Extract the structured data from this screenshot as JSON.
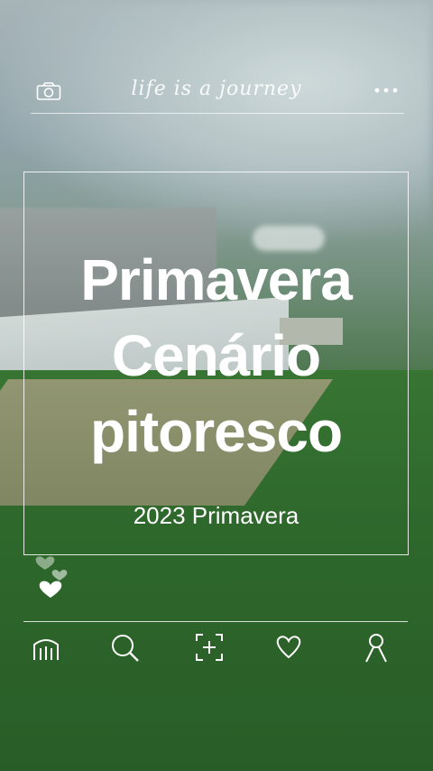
{
  "header": {
    "tagline": "life is a journey",
    "camera_icon": "camera-icon",
    "more_icon": "more-dots-icon"
  },
  "card": {
    "title_lines": [
      "Primavera",
      "Cenário",
      "pitoresco"
    ],
    "subtitle": "2023 Primavera"
  },
  "decor": {
    "hearts_icon": "hearts-icon"
  },
  "nav": {
    "items": [
      {
        "icon": "home-icon"
      },
      {
        "icon": "search-icon"
      },
      {
        "icon": "add-post-icon"
      },
      {
        "icon": "heart-icon"
      },
      {
        "icon": "profile-icon"
      }
    ]
  }
}
